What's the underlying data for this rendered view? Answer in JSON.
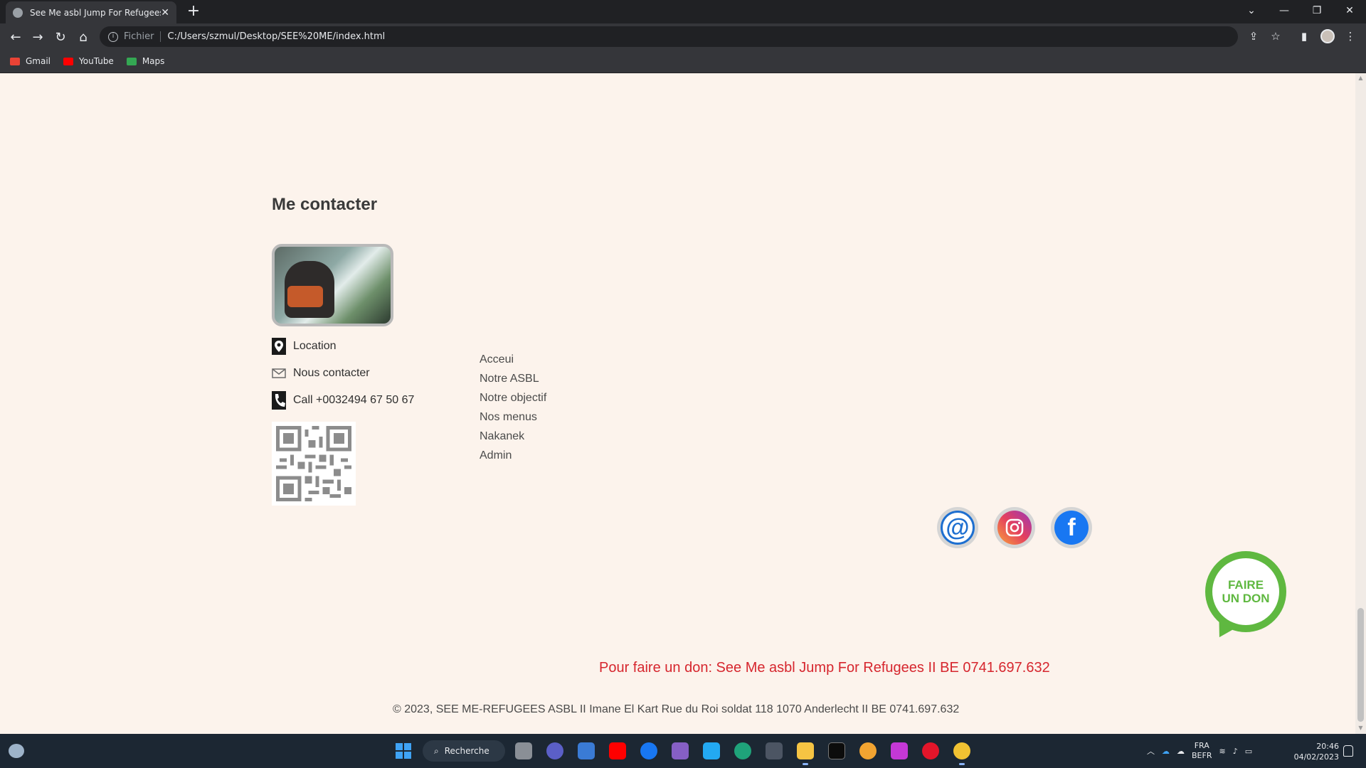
{
  "browser": {
    "tab_title": "See Me asbl Jump For Refugees",
    "tab_close": "✕",
    "new_tab": "+",
    "url_scheme": "Fichier",
    "url": "C:/Users/szmul/Desktop/SEE%20ME/index.html",
    "bookmarks": [
      {
        "label": "Gmail",
        "icon": "gmail-icon",
        "color": "#ea4335"
      },
      {
        "label": "YouTube",
        "icon": "youtube-icon",
        "color": "#ff0000"
      },
      {
        "label": "Maps",
        "icon": "maps-icon",
        "color": "#34a853"
      }
    ]
  },
  "page": {
    "contact_title": "Me contacter",
    "contact": {
      "location": "Location",
      "contact_us": "Nous contacter",
      "call": "Call +0032494 67 50 67"
    },
    "nav": [
      {
        "label": "Acceui"
      },
      {
        "label": "Notre ASBL"
      },
      {
        "label": "Notre objectif"
      },
      {
        "label": "Nos menus"
      },
      {
        "label": "Nakanek"
      },
      {
        "label": "Admin"
      }
    ],
    "social": [
      {
        "name": "email",
        "label": "@",
        "color": "#1e6fd0"
      },
      {
        "name": "instagram",
        "label": "◎",
        "color": "#d6249f"
      },
      {
        "name": "facebook",
        "label": "f",
        "color": "#1877f2"
      }
    ],
    "donate_badge_line1": "FAIRE",
    "donate_badge_line2": "UN DON",
    "donate_text": "Pour faire un don: See Me asbl Jump For Refugees II BE 0741.697.632",
    "copyright": "© 2023, SEE ME-REFUGEES ASBL II Imane El Kart Rue du Roi soldat 118 1070 Anderlecht II BE 0741.697.632",
    "accent_color": "#d6262e",
    "background_color": "#fcf3ec"
  },
  "taskbar": {
    "search_label": "Recherche",
    "lang_line1": "FRA",
    "lang_line2": "BEFR",
    "time": "20:46",
    "date": "04/02/2023"
  }
}
